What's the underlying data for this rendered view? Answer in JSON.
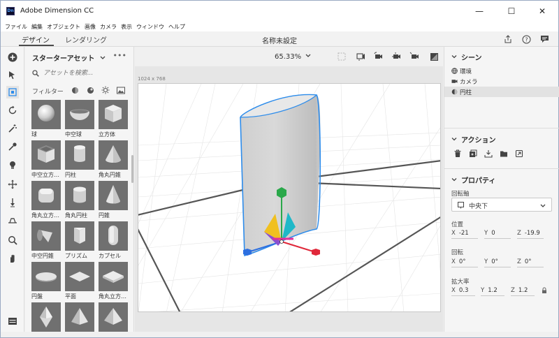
{
  "window": {
    "app_icon_text": "Dn",
    "title": "Adobe Dimension CC",
    "minimize_glyph": "—",
    "maximize_glyph": "☐",
    "close_glyph": "✕"
  },
  "menu": [
    "ファイル",
    "編集",
    "オブジェクト",
    "画像",
    "カメラ",
    "表示",
    "ウィンドウ",
    "ヘルプ"
  ],
  "tabs": {
    "design": "デザイン",
    "render": "レンダリング"
  },
  "document_title": "名称未設定",
  "top_right_icons": [
    "share-icon",
    "help-icon",
    "comment-icon"
  ],
  "tools": [
    "add-icon",
    "select-icon",
    "transform-icon",
    "orbit-icon",
    "magic-wand-icon",
    "eyedropper-icon",
    "paint-icon",
    "pan-camera-icon",
    "dolly-icon",
    "horizon-icon",
    "zoom-icon",
    "hand-icon",
    "layers-icon"
  ],
  "assets": {
    "header": "スターターアセット",
    "more": "•••",
    "search_placeholder": "アセットを検索...",
    "filter_label": "フィルター",
    "filter_icons": [
      "model-filter-icon",
      "material-filter-icon",
      "light-filter-icon",
      "image-filter-icon"
    ],
    "items": [
      {
        "label": "球",
        "shape": "sphere"
      },
      {
        "label": "中空球",
        "shape": "bowl"
      },
      {
        "label": "立方体",
        "shape": "cube"
      },
      {
        "label": "中空立方…",
        "shape": "hollow-cube"
      },
      {
        "label": "円柱",
        "shape": "cylinder"
      },
      {
        "label": "角丸円錐",
        "shape": "round-cone"
      },
      {
        "label": "角丸立方…",
        "shape": "round-cube"
      },
      {
        "label": "角丸円柱",
        "shape": "round-cylinder"
      },
      {
        "label": "円錐",
        "shape": "cone"
      },
      {
        "label": "中空円錐",
        "shape": "hollow-cone"
      },
      {
        "label": "プリズム",
        "shape": "prism"
      },
      {
        "label": "カプセル",
        "shape": "capsule"
      },
      {
        "label": "円盤",
        "shape": "disc"
      },
      {
        "label": "平面",
        "shape": "plane"
      },
      {
        "label": "角丸立方…",
        "shape": "round-slab"
      },
      {
        "label": "",
        "shape": "octahedron"
      },
      {
        "label": "",
        "shape": "pyramid"
      },
      {
        "label": "",
        "shape": "pyramid2"
      }
    ]
  },
  "viewport": {
    "zoom": "65.33%",
    "canvas_size": "1024 x 768",
    "toolbar_icons": [
      "frame-icon",
      "camera-bookmark-icon",
      "camera-rotate-icon",
      "camera-pan-icon",
      "camera-dolly-icon",
      "render-preview-icon"
    ]
  },
  "scene": {
    "header": "シーン",
    "items": [
      {
        "label": "環境",
        "icon": "globe-icon",
        "selected": false
      },
      {
        "label": "カメラ",
        "icon": "camera-icon",
        "selected": false
      },
      {
        "label": "円柱",
        "icon": "object-icon",
        "selected": true
      }
    ]
  },
  "actions": {
    "header": "アクション",
    "icons": [
      "delete-icon",
      "duplicate-icon",
      "place-icon",
      "folder-icon",
      "export-icon"
    ]
  },
  "properties": {
    "header": "プロパティ",
    "pivot_label": "回転軸",
    "pivot_value": "中央下",
    "position_label": "位置",
    "position": {
      "x": "-21",
      "y": "0",
      "z": "-19.9"
    },
    "rotation_label": "回転",
    "rotation": {
      "x": "0°",
      "y": "0°",
      "z": "0°"
    },
    "scale_label": "拡大率",
    "scale": {
      "x": "0.3",
      "y": "1.2",
      "z": "1.2"
    }
  },
  "colors": {
    "accent_blue": "#2d8ceb",
    "gizmo_green": "#2aa84a",
    "gizmo_red": "#e0283a",
    "gizmo_blue": "#2d6fe0"
  }
}
